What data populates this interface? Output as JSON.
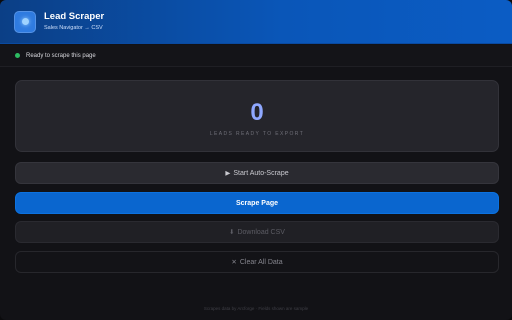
{
  "header": {
    "title": "Lead Scraper",
    "subtitle": "Sales Navigator → CSV"
  },
  "status": {
    "text": "Ready to scrape this page",
    "color": "#2dbb62"
  },
  "counter": {
    "value": "0",
    "label": "LEADS READY TO EXPORT"
  },
  "buttons": {
    "auto_scrape": {
      "icon": "▶",
      "label": "Start Auto-Scrape"
    },
    "scrape_page": {
      "label": "Scrape Page"
    },
    "download_csv": {
      "icon": "⬇",
      "label": "Download CSV"
    },
    "clear_data": {
      "icon": "✕",
      "label": "Clear All Data"
    }
  },
  "footer": {
    "text": "Scrapes data by Arcforge · Fields shown are sample"
  },
  "colors": {
    "accent": "#0a66cf",
    "header": "#0b56b8",
    "counter": "#8fa8ff"
  }
}
